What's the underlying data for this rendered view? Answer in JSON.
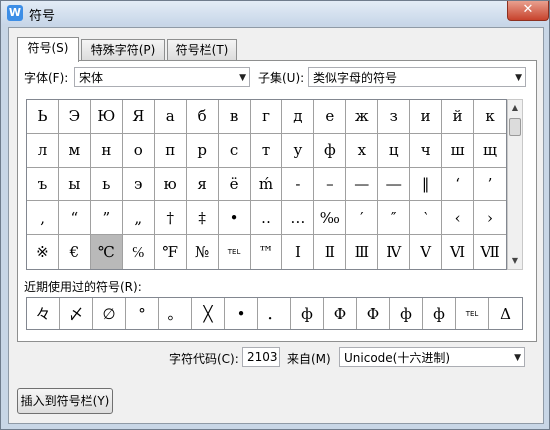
{
  "window": {
    "title": "符号",
    "close_label": "✕"
  },
  "tabs": [
    {
      "label": "符号(S)"
    },
    {
      "label": "特殊字符(P)"
    },
    {
      "label": "符号栏(T)"
    }
  ],
  "font": {
    "label": "字体(F):",
    "value": "宋体"
  },
  "subset": {
    "label": "子集(U):",
    "value": "类似字母的符号"
  },
  "symbols": [
    "Ь",
    "Э",
    "Ю",
    "Я",
    "а",
    "б",
    "в",
    "г",
    "д",
    "е",
    "ж",
    "з",
    "и",
    "й",
    "к",
    "л",
    "м",
    "н",
    "о",
    "п",
    "р",
    "с",
    "т",
    "у",
    "ф",
    "х",
    "ц",
    "ч",
    "ш",
    "щ",
    "ъ",
    "ы",
    "ь",
    "э",
    "ю",
    "я",
    "ё",
    "ḿ",
    "‐",
    "–",
    "—",
    "―",
    "‖",
    "‘",
    "’",
    "‚",
    "“",
    "”",
    "„",
    "†",
    "‡",
    "•",
    "‥",
    "…",
    "‰",
    "′",
    "″",
    "‵",
    "‹",
    "›",
    "※",
    "€",
    "℃",
    "℅",
    "℉",
    "№",
    "TEL",
    "™",
    "Ⅰ",
    "Ⅱ",
    "Ⅲ",
    "Ⅳ",
    "Ⅴ",
    "Ⅵ",
    "Ⅶ"
  ],
  "selected_index": 62,
  "recent": {
    "label": "近期使用过的符号(R):",
    "symbols": [
      "々",
      "〆",
      "∅",
      "°",
      "。",
      "╳",
      "•",
      "．",
      "ф",
      "Ф",
      "Ф",
      "ф",
      "ф",
      "TEL",
      "Δ"
    ]
  },
  "char_code": {
    "label": "字符代码(C):",
    "value": "2103"
  },
  "from": {
    "label": "来自(M)",
    "value": "Unicode(十六进制)"
  },
  "buttons": {
    "insert_to_bar": "插入到符号栏(Y)"
  },
  "colors": {
    "selected_cell": "#b9b9b9",
    "title_bar": "#c7d6e8",
    "close_button": "#c7432d"
  }
}
